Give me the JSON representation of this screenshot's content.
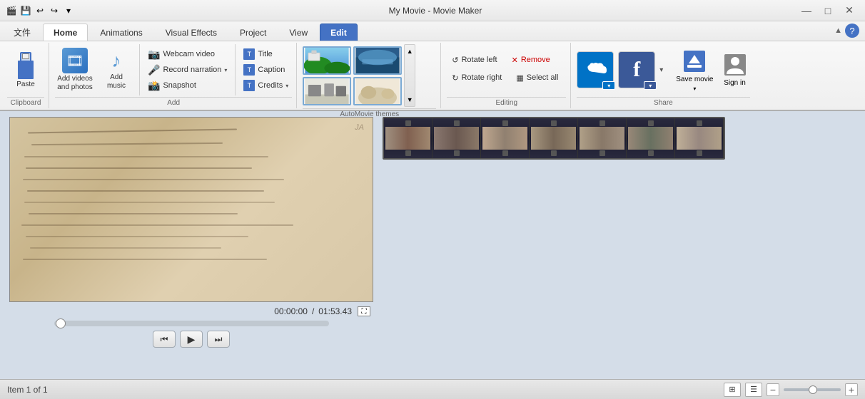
{
  "titlebar": {
    "app_title": "My Movie - Movie Maker",
    "minimize_label": "—",
    "maximize_label": "□",
    "close_label": "✕"
  },
  "ribbon_tabs": {
    "file_label": "文件",
    "home_label": "Home",
    "animations_label": "Animations",
    "visual_effects_label": "Visual Effects",
    "project_label": "Project",
    "view_label": "View",
    "edit_label": "Edit",
    "active_tab": "Edit"
  },
  "ribbon": {
    "clipboard": {
      "label": "Clipboard",
      "paste_label": "Paste"
    },
    "add": {
      "label": "Add",
      "add_videos_label": "Add videos\nand photos",
      "add_music_label": "Add\nmusic",
      "webcam_label": "Webcam video",
      "record_narration_label": "Record narration",
      "snapshot_label": "Snapshot",
      "title_label": "Title",
      "caption_label": "Caption",
      "credits_label": "Credits"
    },
    "automovie_themes": {
      "label": "AutoMovie themes"
    },
    "editing": {
      "label": "Editing",
      "rotate_left_label": "Rotate left",
      "rotate_right_label": "Rotate right",
      "remove_label": "Remove",
      "select_all_label": "Select all"
    },
    "share": {
      "label": "Share",
      "save_movie_label": "Save\nmovie",
      "sign_in_label": "Sign\nin"
    }
  },
  "playback": {
    "time_current": "00:00:00",
    "time_total": "01:53.43",
    "time_separator": "/"
  },
  "transport": {
    "rewind_label": "⏮",
    "play_label": "▶",
    "forward_label": "⏭"
  },
  "status_bar": {
    "item_info": "Item 1 of 1",
    "zoom_out_label": "−",
    "zoom_in_label": "+"
  }
}
